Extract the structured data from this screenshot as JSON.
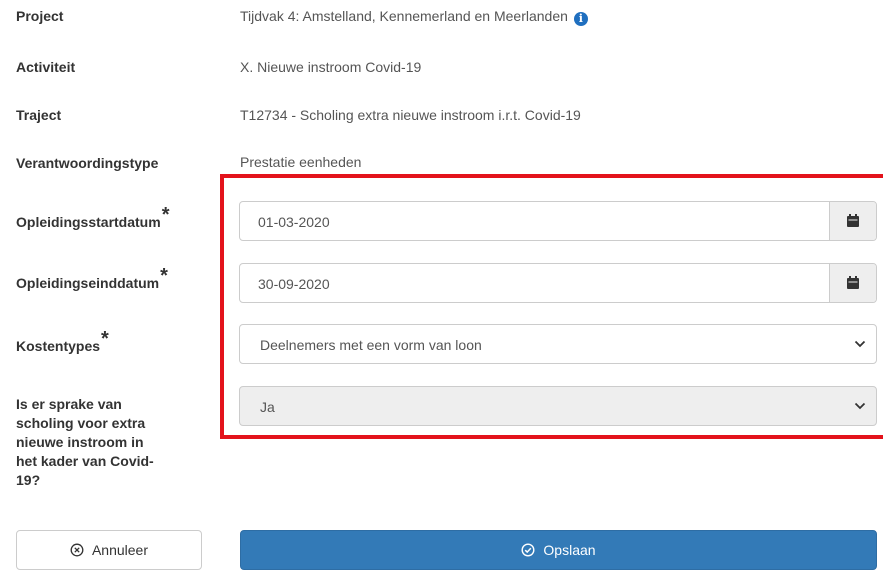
{
  "rows": {
    "project": {
      "label": "Project",
      "value": "Tijdvak 4: Amstelland, Kennemerland en Meerlanden"
    },
    "activiteit": {
      "label": "Activiteit",
      "value": "X. Nieuwe instroom Covid-19"
    },
    "traject": {
      "label": "Traject",
      "value": "T12734 - Scholing extra nieuwe instroom i.r.t. Covid-19"
    },
    "verantwoordingstype": {
      "label": "Verantwoordingstype",
      "value": "Prestatie eenheden"
    }
  },
  "form": {
    "required_marker": "*",
    "startdatum": {
      "label": "Opleidingsstartdatum",
      "value": "01-03-2020"
    },
    "einddatum": {
      "label": "Opleidingseinddatum",
      "value": "30-09-2020"
    },
    "kostentypes": {
      "label": "Kostentypes",
      "value": "Deelnemers met een vorm van loon"
    },
    "covid": {
      "label_lines": [
        "Is er sprake van",
        "scholing voor extra",
        "nieuwe instroom in",
        "het kader van Covid-",
        "19?"
      ],
      "value": "Ja"
    }
  },
  "buttons": {
    "cancel": "Annuleer",
    "save": "Opslaan"
  },
  "icons": {
    "info": "info-circle-icon",
    "calendar": "calendar-icon",
    "chevron": "chevron-down-icon",
    "cancel": "times-circle-icon",
    "save": "check-circle-icon"
  },
  "colors": {
    "highlight": "#e3121b",
    "primary": "#337ab7",
    "info": "#1f6fbf"
  }
}
